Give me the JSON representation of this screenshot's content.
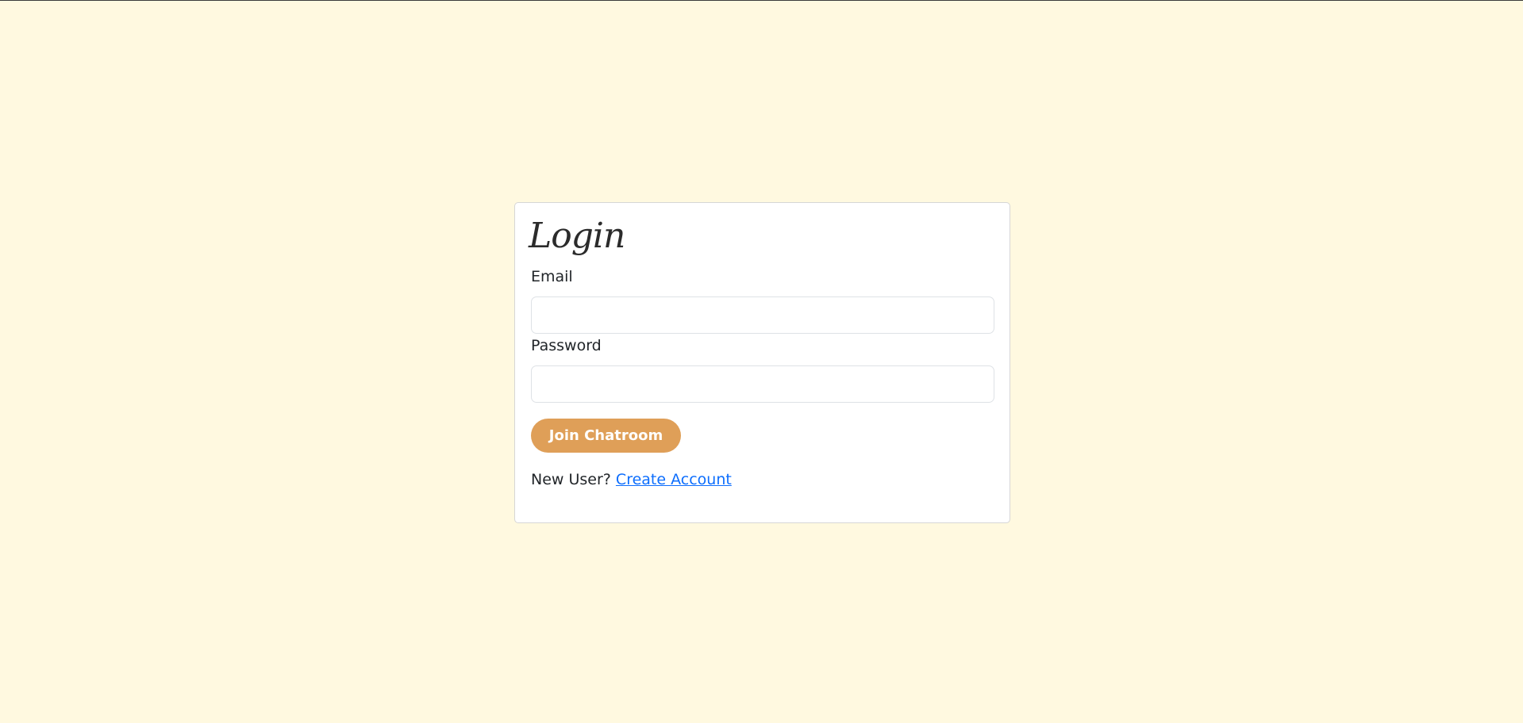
{
  "login": {
    "title": "Login",
    "email_label": "Email",
    "email_value": "",
    "password_label": "Password",
    "password_value": "",
    "submit_label": "Join Chatroom",
    "new_user_text": "New User?",
    "create_account_label": "Create Account"
  },
  "colors": {
    "page_background": "#fff9e0",
    "card_background": "#ffffff",
    "button_background": "#df9f58",
    "link": "#0d6efd"
  }
}
